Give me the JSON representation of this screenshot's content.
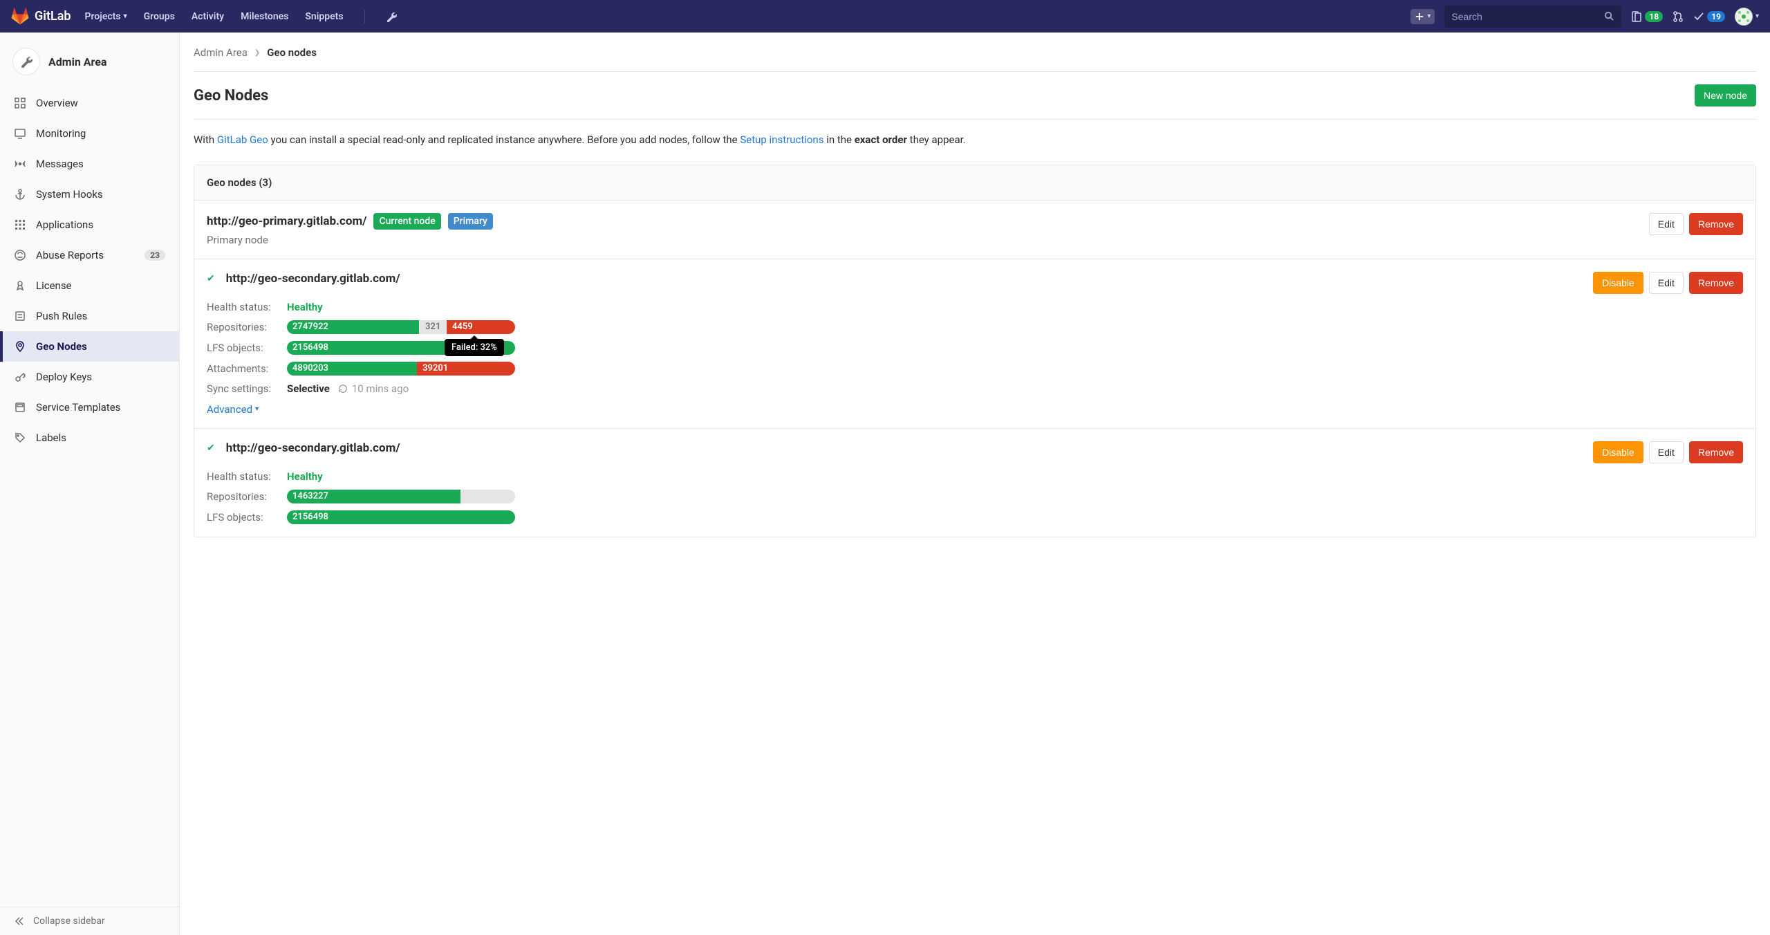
{
  "brand": "GitLab",
  "nav": {
    "projects": "Projects",
    "groups": "Groups",
    "activity": "Activity",
    "milestones": "Milestones",
    "snippets": "Snippets"
  },
  "search": {
    "placeholder": "Search"
  },
  "badges": {
    "issues": "18",
    "todos": "19"
  },
  "sidebar": {
    "title": "Admin Area",
    "items": {
      "overview": "Overview",
      "monitoring": "Monitoring",
      "messages": "Messages",
      "system_hooks": "System Hooks",
      "applications": "Applications",
      "abuse_reports": "Abuse Reports",
      "abuse_count": "23",
      "license": "License",
      "push_rules": "Push Rules",
      "geo_nodes": "Geo Nodes",
      "deploy_keys": "Deploy Keys",
      "service_templates": "Service Templates",
      "labels": "Labels"
    },
    "collapse": "Collapse sidebar"
  },
  "breadcrumb": {
    "root": "Admin Area",
    "current": "Geo nodes"
  },
  "page": {
    "title": "Geo Nodes",
    "new_btn": "New node"
  },
  "intro": {
    "p1": "With ",
    "link1": "GitLab Geo",
    "p2": " you can install a special read-only and replicated instance anywhere. Before you add nodes, follow the ",
    "link2": "Setup instructions",
    "p3": " in the ",
    "bold": "exact order",
    "p4": " they appear."
  },
  "panel": {
    "header": "Geo nodes (3)"
  },
  "btn": {
    "edit": "Edit",
    "remove": "Remove",
    "disable": "Disable"
  },
  "labels": {
    "health": "Health status:",
    "repos": "Repositories:",
    "lfs": "LFS objects:",
    "attach": "Attachments:",
    "sync": "Sync settings:",
    "advanced": "Advanced"
  },
  "primary": {
    "url": "http://geo-primary.gitlab.com/",
    "tag1": "Current node",
    "tag2": "Primary",
    "sub": "Primary node"
  },
  "sec1": {
    "url": "http://geo-secondary.gitlab.com/",
    "health": "Healthy",
    "repos_ok": "2747922",
    "repos_mid": "321",
    "repos_fail": "4459",
    "lfs_ok": "2156498",
    "att_ok": "4890203",
    "att_fail": "39201",
    "sync_mode": "Selective",
    "sync_time": "10 mins ago",
    "tooltip": "Failed: 32%"
  },
  "sec2": {
    "url": "http://geo-secondary.gitlab.com/",
    "health": "Healthy",
    "repos_ok": "1463227",
    "lfs_ok": "2156498"
  }
}
